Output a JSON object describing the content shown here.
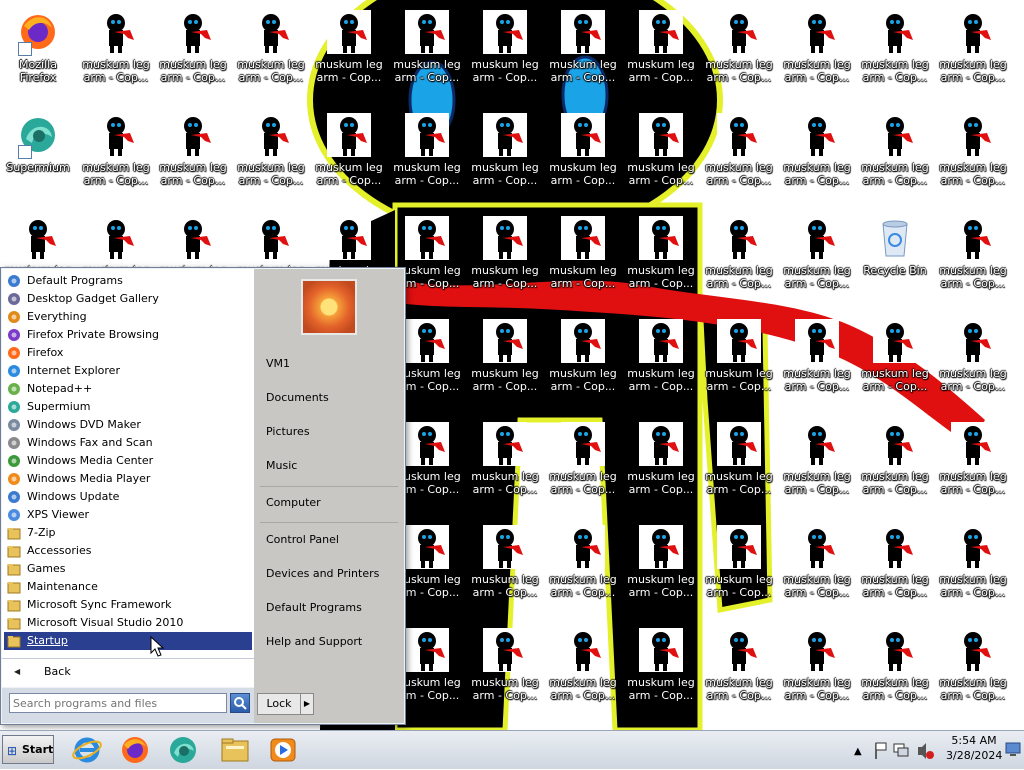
{
  "desktop": {
    "icon_label": "muskum leg\narm - Cop...",
    "special_icons": {
      "firefox_label": "Mozilla Firefox",
      "supermium_label": "Supermium",
      "recycle_label": "Recycle Bin"
    },
    "colors": {
      "figure": "#000000",
      "figure_outline": "#e3f02a",
      "scarf": "#e01010",
      "eye": "#1ba3e8"
    }
  },
  "start_menu": {
    "programs": [
      {
        "label": "Default Programs",
        "icon": "default-programs-icon"
      },
      {
        "label": "Desktop Gadget Gallery",
        "icon": "gadget-icon"
      },
      {
        "label": "Everything",
        "icon": "search-magnifier-icon"
      },
      {
        "label": "Firefox Private Browsing",
        "icon": "firefox-private-icon"
      },
      {
        "label": "Firefox",
        "icon": "firefox-icon"
      },
      {
        "label": "Internet Explorer",
        "icon": "internet-explorer-icon"
      },
      {
        "label": "Notepad++",
        "icon": "notepad-plus-icon"
      },
      {
        "label": "Supermium",
        "icon": "supermium-icon"
      },
      {
        "label": "Windows DVD Maker",
        "icon": "dvd-maker-icon"
      },
      {
        "label": "Windows Fax and Scan",
        "icon": "fax-scan-icon"
      },
      {
        "label": "Windows Media Center",
        "icon": "media-center-icon"
      },
      {
        "label": "Windows Media Player",
        "icon": "media-player-icon"
      },
      {
        "label": "Windows Update",
        "icon": "windows-update-icon"
      },
      {
        "label": "XPS Viewer",
        "icon": "xps-viewer-icon"
      },
      {
        "label": "7-Zip",
        "icon": "folder-icon"
      },
      {
        "label": "Accessories",
        "icon": "folder-icon"
      },
      {
        "label": "Games",
        "icon": "folder-icon"
      },
      {
        "label": "Maintenance",
        "icon": "folder-icon"
      },
      {
        "label": "Microsoft Sync Framework",
        "icon": "folder-icon"
      },
      {
        "label": "Microsoft Visual Studio 2010",
        "icon": "folder-icon"
      },
      {
        "label": "Startup",
        "icon": "folder-icon",
        "selected": true
      }
    ],
    "back_label": "Back",
    "search_placeholder": "Search programs and files",
    "right_pane": {
      "user": "VM1",
      "documents": "Documents",
      "pictures": "Pictures",
      "music": "Music",
      "computer": "Computer",
      "control_panel": "Control Panel",
      "devices_printers": "Devices and Printers",
      "default_programs": "Default Programs",
      "help_support": "Help and Support"
    },
    "lock_label": "Lock"
  },
  "taskbar": {
    "start_label": "Start",
    "pinned": [
      "internet-explorer-icon",
      "firefox-icon",
      "supermium-icon",
      "windows-explorer-icon",
      "media-player-icon"
    ],
    "clock_time": "5:54 AM",
    "clock_date": "3/28/2024"
  }
}
